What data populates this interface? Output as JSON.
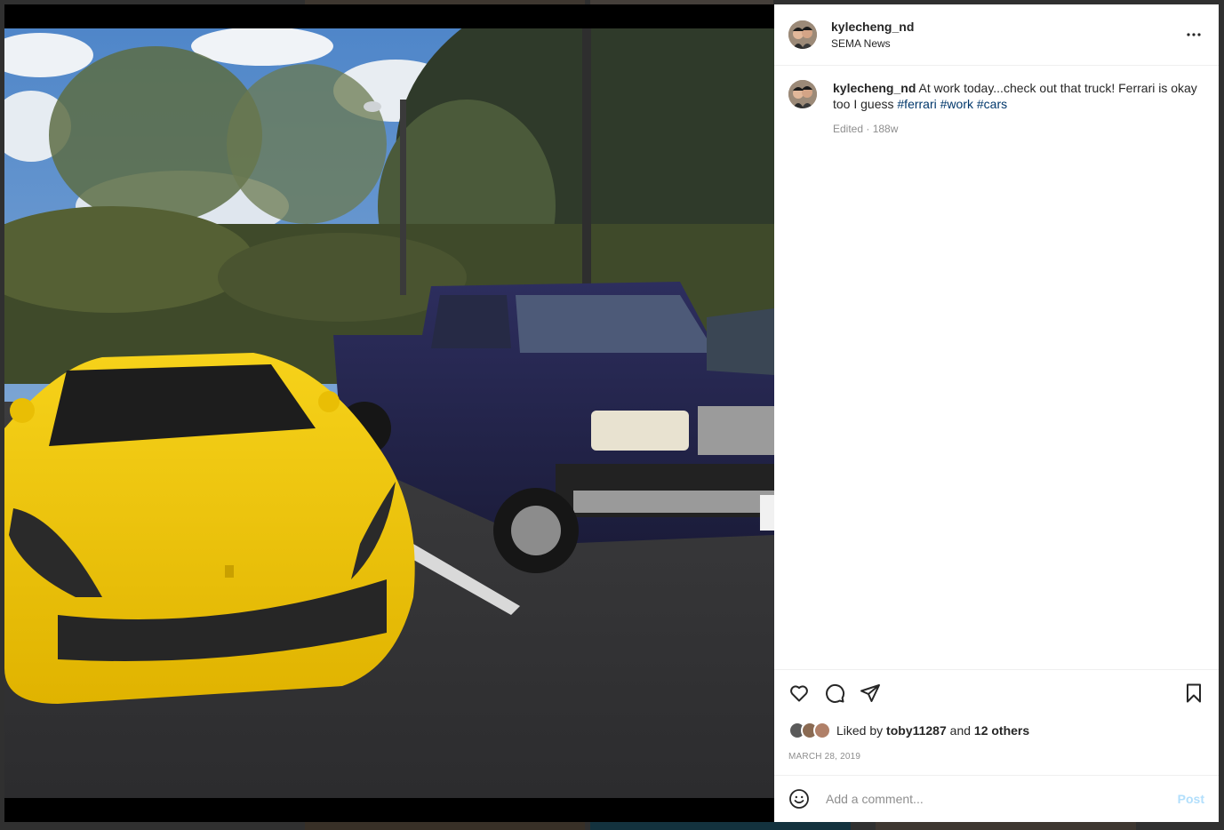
{
  "post": {
    "username": "kylecheng_nd",
    "location": "SEMA News",
    "more_icon": "more-horizontal-icon"
  },
  "caption": {
    "username": "kylecheng_nd",
    "text": "At work today...check out that truck! Ferrari is okay too I guess",
    "hashtags": [
      "#ferrari",
      "#work",
      "#cars"
    ],
    "edited": "Edited",
    "age": "188w"
  },
  "actions": {
    "like_icon": "heart-icon",
    "comment_icon": "comment-bubble-icon",
    "share_icon": "paper-plane-icon",
    "save_icon": "bookmark-icon"
  },
  "likes": {
    "prefix": "Liked by",
    "user": "toby11287",
    "and": "and",
    "others": "12 others"
  },
  "date": "MARCH 28, 2019",
  "comment": {
    "placeholder": "Add a comment...",
    "post_label": "Post",
    "emoji_icon": "smiley-icon"
  },
  "colors": {
    "link": "#00376b",
    "post_button_disabled": "#b2dffc",
    "muted": "#8e8e8e"
  }
}
